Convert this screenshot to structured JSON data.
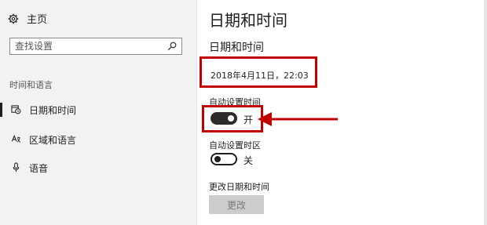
{
  "sidebar": {
    "home_label": "主页",
    "search_placeholder": "查找设置",
    "section_label": "时间和语言",
    "items": [
      {
        "label": "日期和时间",
        "icon": "calendar-clock-icon",
        "active": true
      },
      {
        "label": "区域和语言",
        "icon": "language-icon",
        "active": false
      },
      {
        "label": "语音",
        "icon": "microphone-icon",
        "active": false
      }
    ]
  },
  "main": {
    "page_title": "日期和时间",
    "section_title": "日期和时间",
    "current_datetime": "2018年4月11日，22:03",
    "auto_time": {
      "label": "自动设置时间",
      "state_text": "开",
      "on": true
    },
    "auto_timezone": {
      "label": "自动设置时区",
      "state_text": "关",
      "on": false
    },
    "change_datetime": {
      "label": "更改日期和时间",
      "button_label": "更改",
      "enabled": false
    }
  },
  "colors": {
    "annotation_red": "#c00000",
    "toggle_on": "#2b2b2b",
    "sidebar_bg": "#f2f2f2",
    "disabled_button_bg": "#cccccc"
  }
}
